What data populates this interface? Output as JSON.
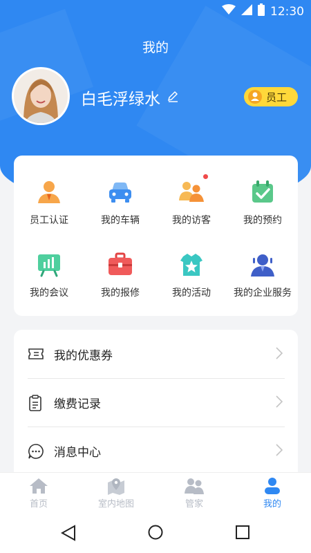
{
  "status": {
    "time": "12:30"
  },
  "header": {
    "title": "我的"
  },
  "profile": {
    "name": "白毛浮绿水",
    "role": "员工"
  },
  "services": [
    {
      "label": "员工认证",
      "icon": "employee-cert-icon"
    },
    {
      "label": "我的车辆",
      "icon": "car-icon"
    },
    {
      "label": "我的访客",
      "icon": "visitors-icon",
      "badge": true
    },
    {
      "label": "我的预约",
      "icon": "calendar-check-icon"
    },
    {
      "label": "我的会议",
      "icon": "meeting-board-icon"
    },
    {
      "label": "我的报修",
      "icon": "toolbox-icon"
    },
    {
      "label": "我的活动",
      "icon": "activity-star-icon"
    },
    {
      "label": "我的企业服务",
      "icon": "enterprise-service-icon"
    }
  ],
  "menu": [
    {
      "label": "我的优惠券",
      "icon": "coupon-icon"
    },
    {
      "label": "缴费记录",
      "icon": "clipboard-icon"
    },
    {
      "label": "消息中心",
      "icon": "message-icon"
    }
  ],
  "tabs": [
    {
      "label": "首页",
      "icon": "home-icon"
    },
    {
      "label": "室内地图",
      "icon": "map-icon"
    },
    {
      "label": "管家",
      "icon": "butler-icon"
    },
    {
      "label": "我的",
      "icon": "profile-icon",
      "active": true
    }
  ],
  "colors": {
    "primary": "#2f88f2",
    "badge": "#ffd83a",
    "inactive_tab": "#b7bcc6"
  }
}
